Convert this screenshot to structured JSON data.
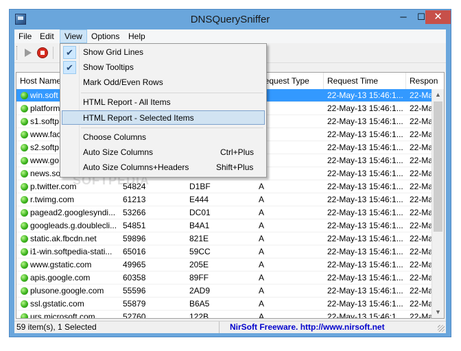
{
  "window": {
    "title": "DNSQuerySniffer",
    "min_glyph": "─",
    "max_glyph": "☐",
    "close_glyph": "✕"
  },
  "menubar": [
    "File",
    "Edit",
    "View",
    "Options",
    "Help"
  ],
  "view_menu": {
    "items": [
      {
        "label": "Show Grid Lines",
        "checked": true
      },
      {
        "label": "Show Tooltips",
        "checked": true
      },
      {
        "label": "Mark Odd/Even Rows",
        "checked": false
      },
      {
        "label": "HTML Report - All Items"
      },
      {
        "label": "HTML Report - Selected Items",
        "highlighted": true
      },
      {
        "label": "Choose Columns"
      },
      {
        "label": "Auto Size Columns",
        "shortcut": "Ctrl+Plus"
      },
      {
        "label": "Auto Size Columns+Headers",
        "shortcut": "Shift+Plus"
      }
    ],
    "check_glyph": "✔"
  },
  "table": {
    "columns": [
      "Host Name",
      "",
      "",
      "Request Type",
      "Request Time",
      "Respon"
    ],
    "rows": [
      [
        "win.soft",
        "",
        "",
        "",
        "22-May-13 15:46:1...",
        "22-May"
      ],
      [
        "platform",
        "",
        "",
        "",
        "22-May-13 15:46:1...",
        "22-May"
      ],
      [
        "s1.softp",
        "",
        "",
        "",
        "22-May-13 15:46:1...",
        "22-May"
      ],
      [
        "www.fac",
        "",
        "",
        "",
        "22-May-13 15:46:1...",
        "22-May"
      ],
      [
        "s2.softp",
        "",
        "",
        "",
        "22-May-13 15:46:1...",
        "22-May"
      ],
      [
        "www.go",
        "",
        "",
        "",
        "22-May-13 15:46:1...",
        "22-May"
      ],
      [
        "news.so",
        "",
        "",
        "",
        "22-May-13 15:46:1...",
        "22-May"
      ],
      [
        "p.twitter.com",
        "54824",
        "D1BF",
        "A",
        "22-May-13 15:46:1...",
        "22-May"
      ],
      [
        "r.twimg.com",
        "61213",
        "E444",
        "A",
        "22-May-13 15:46:1...",
        "22-May"
      ],
      [
        "pagead2.googlesyndi...",
        "53266",
        "DC01",
        "A",
        "22-May-13 15:46:1...",
        "22-May"
      ],
      [
        "googleads.g.doublecli...",
        "54851",
        "B4A1",
        "A",
        "22-May-13 15:46:1...",
        "22-May"
      ],
      [
        "static.ak.fbcdn.net",
        "59896",
        "821E",
        "A",
        "22-May-13 15:46:1...",
        "22-May"
      ],
      [
        "i1-win.softpedia-stati...",
        "65016",
        "59CC",
        "A",
        "22-May-13 15:46:1...",
        "22-May"
      ],
      [
        "www.gstatic.com",
        "49965",
        "205E",
        "A",
        "22-May-13 15:46:1...",
        "22-May"
      ],
      [
        "apis.google.com",
        "60358",
        "89FF",
        "A",
        "22-May-13 15:46:1...",
        "22-May"
      ],
      [
        "plusone.google.com",
        "55596",
        "2AD9",
        "A",
        "22-May-13 15:46:1...",
        "22-May"
      ],
      [
        "ssl.gstatic.com",
        "55879",
        "B6A5",
        "A",
        "22-May-13 15:46:1...",
        "22-May"
      ],
      [
        "urs.microsoft.com",
        "52760",
        "122B",
        "A",
        "22-May-13 15:46:1...",
        "22-May"
      ]
    ]
  },
  "scrollbar": {
    "up_glyph": "▲",
    "down_glyph": "▼"
  },
  "status": {
    "items_text": "59 item(s), 1 Selected",
    "link_text": "NirSoft Freeware.  http://www.nirsoft.net"
  },
  "watermark": "SOFTPEDIA"
}
